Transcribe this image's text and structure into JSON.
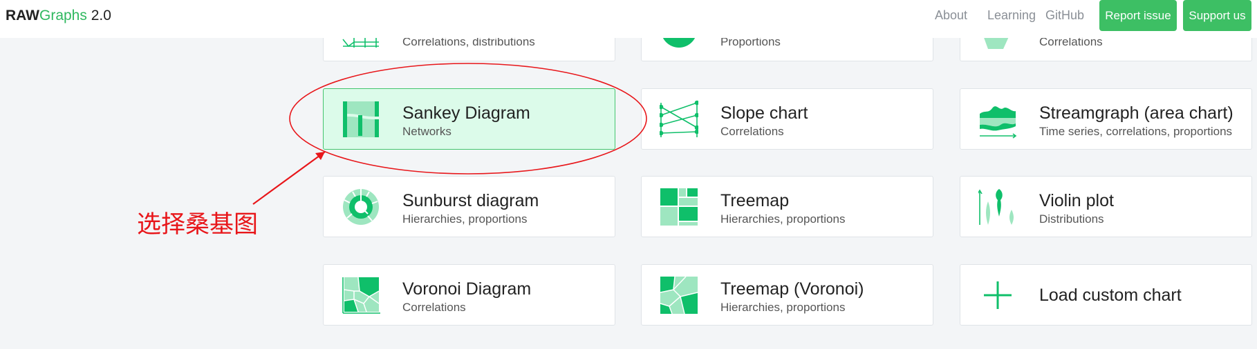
{
  "navbar": {
    "brand_bold": "RAW",
    "brand_green": "Graphs",
    "brand_version": " 2.0",
    "links": [
      "About",
      "Learning",
      "GitHub"
    ],
    "report_label": "Report issue",
    "support_label": "Support us"
  },
  "colors": {
    "accent": "#3dbf64",
    "selected_bg": "#dcfbea",
    "icon_green": "#0fbf6a",
    "icon_light": "#9ee6c0",
    "annotation_red": "#e8161a"
  },
  "cards": [
    {
      "title": "",
      "sub": "Correlations, distributions",
      "icon": "bar-chart-icon"
    },
    {
      "title": "",
      "sub": "Proportions",
      "icon": "pie-chart-icon"
    },
    {
      "title": "",
      "sub": "Correlations",
      "icon": "radar-chart-icon"
    },
    {
      "title": "Sankey Diagram",
      "sub": "Networks",
      "icon": "sankey-icon",
      "selected": true
    },
    {
      "title": "Slope chart",
      "sub": "Correlations",
      "icon": "slope-chart-icon"
    },
    {
      "title": "Streamgraph (area chart)",
      "sub": "Time series, correlations, proportions",
      "icon": "streamgraph-icon"
    },
    {
      "title": "Sunburst diagram",
      "sub": "Hierarchies, proportions",
      "icon": "sunburst-icon"
    },
    {
      "title": "Treemap",
      "sub": "Hierarchies, proportions",
      "icon": "treemap-icon"
    },
    {
      "title": "Violin plot",
      "sub": "Distributions",
      "icon": "violin-plot-icon"
    },
    {
      "title": "Voronoi Diagram",
      "sub": "Correlations",
      "icon": "voronoi-icon"
    },
    {
      "title": "Treemap (Voronoi)",
      "sub": "Hierarchies, proportions",
      "icon": "voronoi-treemap-icon"
    },
    {
      "title": "Load custom chart",
      "sub": "",
      "icon": "plus-icon"
    }
  ],
  "annotation": {
    "label": "选择桑基图"
  }
}
